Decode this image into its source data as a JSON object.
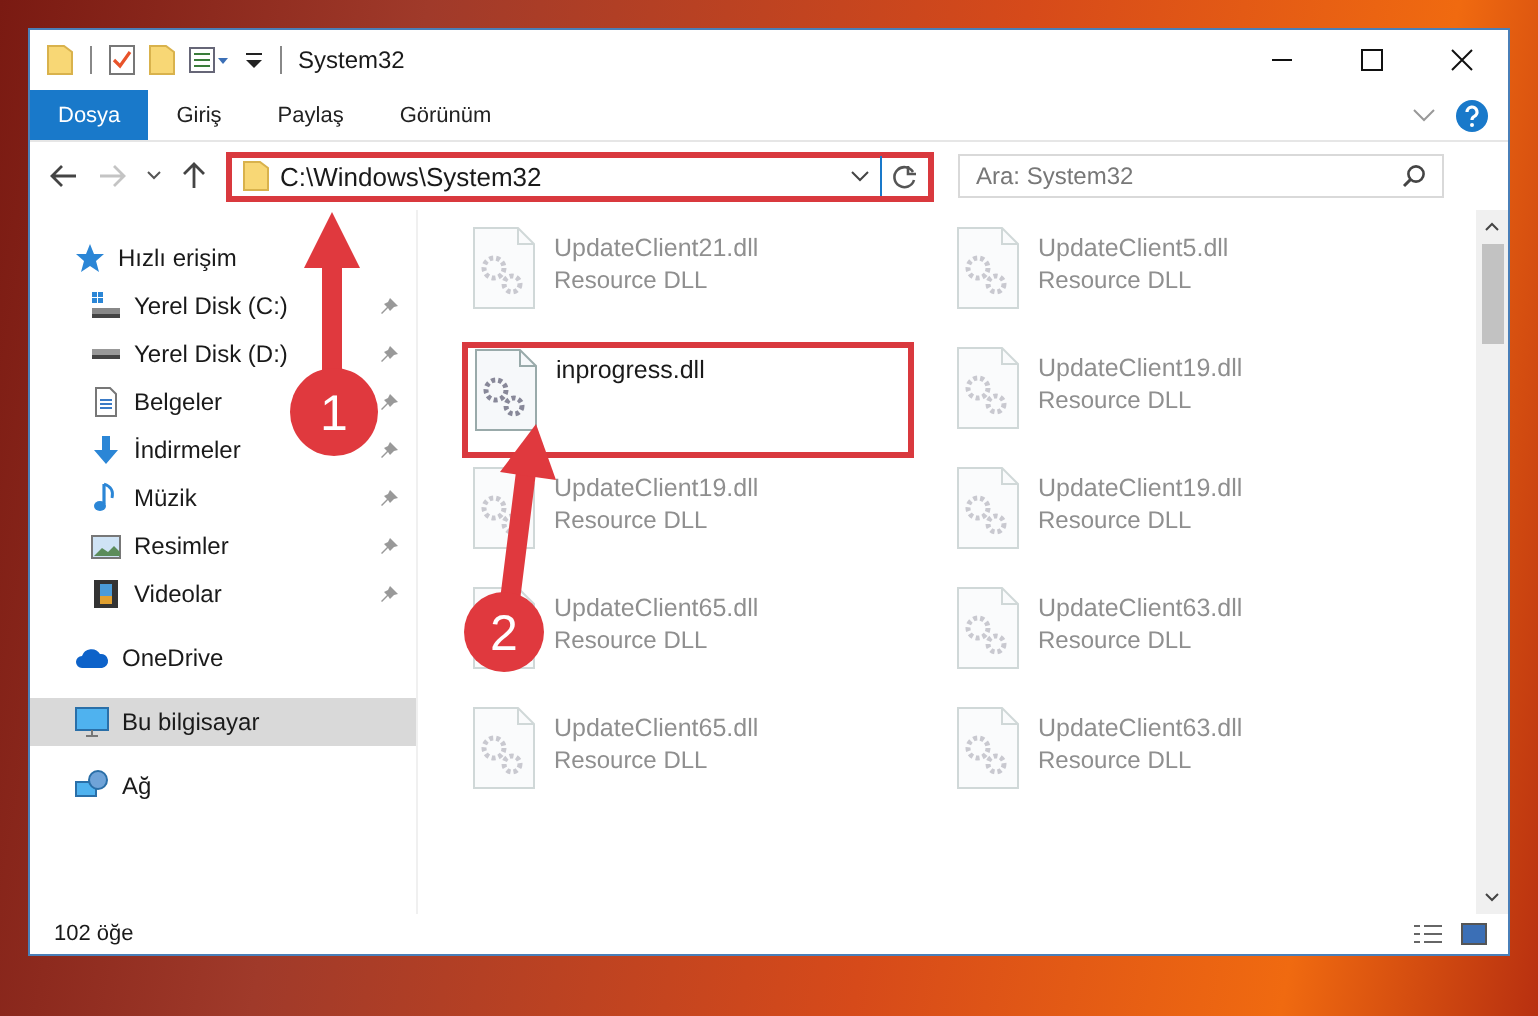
{
  "window": {
    "title": "System32"
  },
  "ribbon_tabs": [
    {
      "label": "Dosya",
      "selected": true
    },
    {
      "label": "Giriş",
      "selected": false
    },
    {
      "label": "Paylaş",
      "selected": false
    },
    {
      "label": "Görünüm",
      "selected": false
    }
  ],
  "navigation": {
    "forward_disabled": true
  },
  "address": {
    "path": "C:\\Windows\\System32",
    "highlighted": true
  },
  "search": {
    "placeholder": "Ara: System32"
  },
  "sidebar": {
    "items": [
      {
        "label": "Hızlı erişim",
        "kind": "star",
        "selected": false,
        "children": [
          {
            "label": "Yerel Disk (C:)",
            "kind": "drive-windows",
            "pinned": true
          },
          {
            "label": "Yerel Disk (D:)",
            "kind": "drive",
            "pinned": true
          },
          {
            "label": "Belgeler",
            "kind": "document",
            "pinned": true
          },
          {
            "label": "İndirmeler",
            "kind": "download",
            "pinned": true
          },
          {
            "label": "Müzik",
            "kind": "music",
            "pinned": true
          },
          {
            "label": "Resimler",
            "kind": "pictures",
            "pinned": true
          },
          {
            "label": "Videolar",
            "kind": "video",
            "pinned": true
          }
        ]
      },
      {
        "label": "OneDrive",
        "kind": "cloud",
        "selected": false
      },
      {
        "label": "Bu bilgisayar",
        "kind": "computer",
        "selected": true
      },
      {
        "label": "Ağ",
        "kind": "network",
        "selected": false
      }
    ]
  },
  "files": [
    {
      "name": "UpdateClient21.dll",
      "type": "Resource DLL",
      "blurred": true,
      "highlighted": false
    },
    {
      "name": "UpdateClient5.dll",
      "type": "Resource DLL",
      "blurred": true,
      "highlighted": false
    },
    {
      "name": "inprogress.dll",
      "blurred": false,
      "highlighted": true
    },
    {
      "name": "UpdateClient19.dll",
      "type": "Resource DLL",
      "blurred": true,
      "highlighted": false
    },
    {
      "name": "UpdateClient19.dll",
      "type": "Resource DLL",
      "blurred": true,
      "highlighted": false
    },
    {
      "name": "UpdateClient19.dll",
      "type": "Resource DLL",
      "blurred": true,
      "highlighted": false
    },
    {
      "name": "UpdateClient65.dll",
      "type": "Resource DLL",
      "blurred": true,
      "highlighted": false
    },
    {
      "name": "UpdateClient63.dll",
      "type": "Resource DLL",
      "blurred": true,
      "highlighted": false
    },
    {
      "name": "UpdateClient65.dll",
      "type": "Resource DLL",
      "blurred": true,
      "highlighted": false
    },
    {
      "name": "UpdateClient63.dll",
      "type": "Resource DLL",
      "blurred": true,
      "highlighted": false
    }
  ],
  "annotations": [
    {
      "number": "1"
    },
    {
      "number": "2"
    }
  ],
  "status_bar": {
    "item_count": "102 öğe"
  }
}
